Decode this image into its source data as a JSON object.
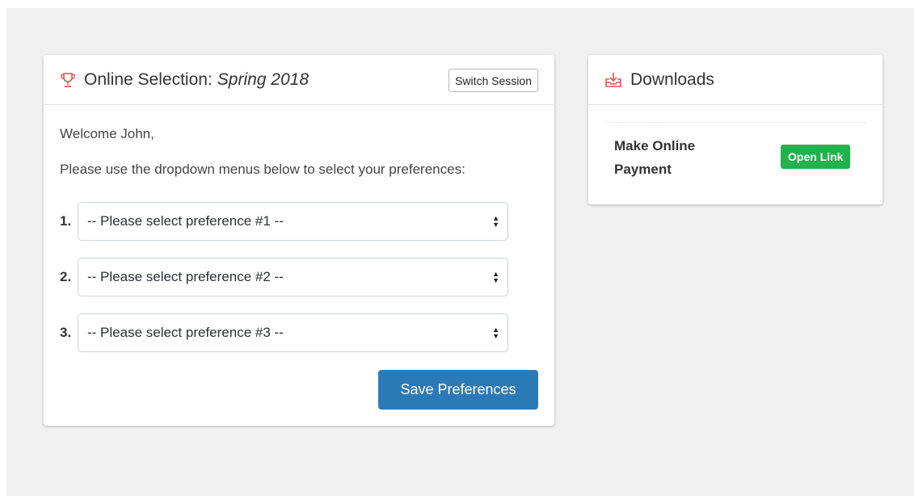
{
  "colors": {
    "background": "#f0f0f0",
    "accent_icon": "#e05555",
    "primary_button": "#2b7ab8",
    "success_button": "#22b14c"
  },
  "selection": {
    "icon": "trophy-icon",
    "title_prefix": "Online Selection:",
    "session": "Spring 2018",
    "switch_label": "Switch Session",
    "welcome": "Welcome John,",
    "instructions": "Please use the dropdown menus below to select your preferences:",
    "preferences": [
      {
        "number": "1.",
        "selected": "-- Please select preference #1 --"
      },
      {
        "number": "2.",
        "selected": "-- Please select preference #2 --"
      },
      {
        "number": "3.",
        "selected": "-- Please select preference #3 --"
      }
    ],
    "save_label": "Save Preferences"
  },
  "downloads": {
    "icon": "download-tray-icon",
    "title": "Downloads",
    "items": [
      {
        "label": "Make Online Payment",
        "button_label": "Open Link"
      }
    ]
  }
}
